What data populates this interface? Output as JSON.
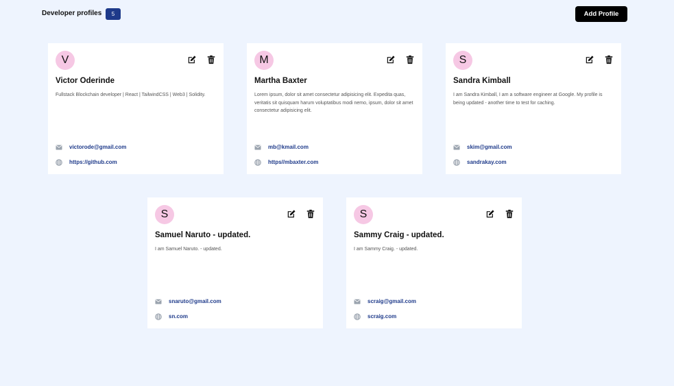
{
  "header": {
    "title": "Developer profiles",
    "count": "5",
    "add_label": "Add Profile"
  },
  "profiles": [
    {
      "initial": "V",
      "name": "Victor Oderinde",
      "bio": "Fullstack Blockchain developer | React | TailwindCSS | Web3 | Solidity.",
      "email": "victorode@gmail.com",
      "website": "https://github.com"
    },
    {
      "initial": "M",
      "name": "Martha Baxter",
      "bio": "Lorem ipsum, dolor sit amet consectetur adipisicing elit. Expedita quas, veritatis sit quisquam harum voluptatibus modi nemo, ipsum, dolor sit amet consectetur adipisicing elit.",
      "email": "mb@kmail.com",
      "website": "https//mbaxter.com"
    },
    {
      "initial": "S",
      "name": "Sandra Kimball",
      "bio": "I am Sandra Kimball, I am a software engineer at Google. My profile is being updated - another time to test for caching.",
      "email": "skim@gmail.com",
      "website": "sandrakay.com"
    },
    {
      "initial": "S",
      "name": "Samuel Naruto - updated.",
      "bio": "I am Samuel Naruto. - updated.",
      "email": "snaruto@gmail.com",
      "website": "sn.com"
    },
    {
      "initial": "S",
      "name": "Sammy Craig - updated.",
      "bio": "I am Sammy Craig. - updated.",
      "email": "scraig@gmail.com",
      "website": "scraig.com"
    }
  ],
  "colors": {
    "background": "#eef4fe",
    "avatar": "#f6c8e4",
    "badge": "#1e3a8a",
    "link": "#1e3a8a",
    "button": "#000000"
  },
  "icons": {
    "edit": "edit-icon",
    "delete": "trash-icon",
    "email": "mail-icon",
    "website": "globe-icon"
  }
}
